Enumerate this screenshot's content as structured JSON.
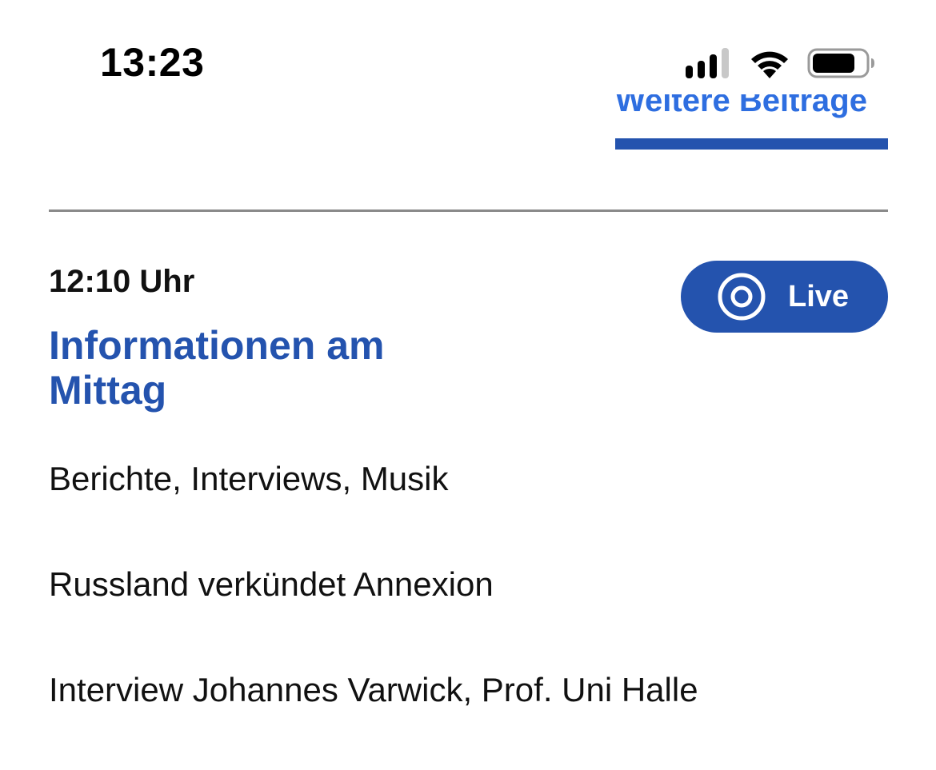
{
  "status_bar": {
    "time": "13:23",
    "signal_icon": "cellular-signal-icon",
    "wifi_icon": "wifi-icon",
    "battery_icon": "battery-icon"
  },
  "more_link": {
    "label": "Weitere Beiträge"
  },
  "program": {
    "time": "12:10 Uhr",
    "title": "Informationen am Mittag",
    "live_button": {
      "label": "Live",
      "icon": "live-radio-icon"
    },
    "items": [
      "Berichte, Interviews, Musik",
      "Russland verkündet Annexion",
      "Interview Johannes Varwick, Prof. Uni Halle"
    ]
  },
  "colors": {
    "accent": "#2453ae",
    "link": "#2e6ee0",
    "divider": "#8a8a8a",
    "text": "#111111"
  }
}
